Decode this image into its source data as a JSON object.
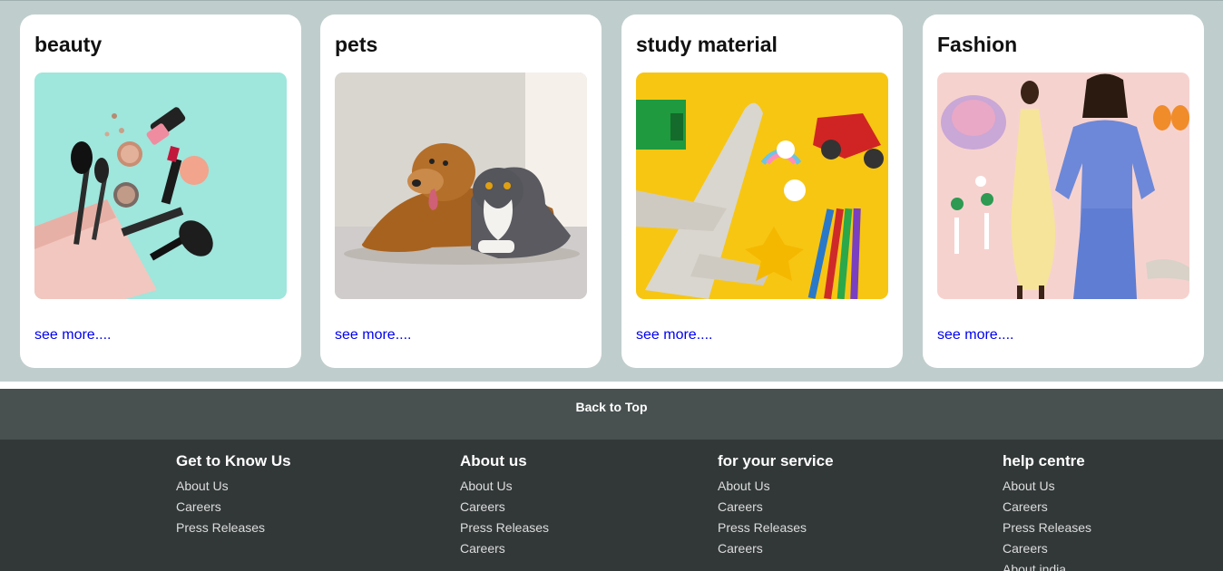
{
  "cards": [
    {
      "title": "beauty",
      "link": "see more....",
      "image": "makeup-products-photo"
    },
    {
      "title": "pets",
      "link": "see more....",
      "image": "dog-and-cat-photo"
    },
    {
      "title": "study material",
      "link": "see more....",
      "image": "toys-and-pencils-photo"
    },
    {
      "title": "Fashion",
      "link": "see more....",
      "image": "fashion-models-photo"
    }
  ],
  "back_to_top": "Back to Top",
  "footer": {
    "columns": [
      {
        "heading": "Get to Know Us",
        "links": [
          "About Us",
          "Careers",
          "Press Releases"
        ]
      },
      {
        "heading": "About us",
        "links": [
          "About Us",
          "Careers",
          "Press Releases",
          "Careers"
        ]
      },
      {
        "heading": "for your service",
        "links": [
          "About Us",
          "Careers",
          "Press Releases",
          "Careers"
        ]
      },
      {
        "heading": "help centre",
        "links": [
          "About Us",
          "Careers",
          "Press Releases",
          "Careers",
          "About india"
        ]
      }
    ]
  },
  "colors": {
    "page_bg": "#c0cdcd",
    "back_to_top_bg": "#485050",
    "footer_bg": "#323838",
    "link": "#0000ee"
  }
}
